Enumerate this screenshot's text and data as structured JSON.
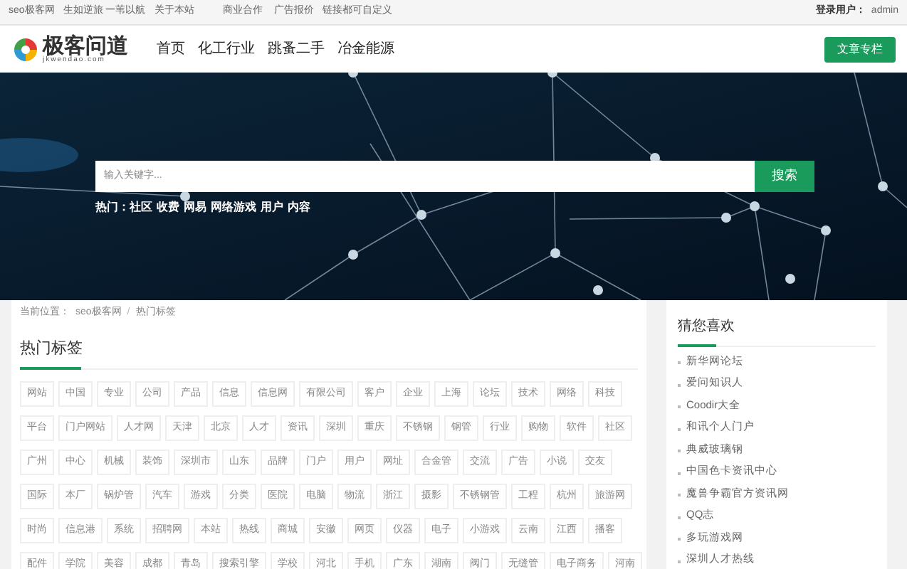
{
  "top_bar": {
    "links": [
      "seo极客网",
      "生如逆旅 一苇以航",
      "关于本站",
      "商业合作",
      "广告报价",
      "链接都可自定义"
    ],
    "user_label": "登录用户：",
    "user_name": "admin"
  },
  "header": {
    "logo_text": "极客问道",
    "logo_sub": "jkwendao.com",
    "nav": [
      "首页",
      "化工行业",
      "跳蚤二手",
      "冶金能源"
    ],
    "button": "文章专栏"
  },
  "banner": {
    "search": {
      "placeholder": "输入关键字...",
      "button": "搜索"
    },
    "hot_label": "热门：",
    "hot_links": [
      "社区",
      "收费",
      "网易",
      "网络游戏",
      "用户",
      "内容"
    ]
  },
  "breadcrumb": {
    "label": "当前位置：",
    "items": [
      "seo极客网",
      "热门标签"
    ],
    "separator": "/"
  },
  "tags": {
    "title": "热门标签",
    "rows": [
      [
        "网站",
        "中国",
        "专业",
        "公司",
        "产品",
        "信息",
        "信息网",
        "有限公司",
        "客户",
        "企业",
        "上海",
        "论坛",
        "技术",
        "网络",
        "科技"
      ],
      [
        "平台",
        "门户网站",
        "人才网",
        "天津",
        "北京",
        "人才",
        "资讯",
        "深圳",
        "重庆",
        "不锈钢",
        "钢管",
        "行业",
        "购物",
        "软件",
        "社区"
      ],
      [
        "广州",
        "中心",
        "机械",
        "装饰",
        "深圳市",
        "山东",
        "品牌",
        "门户",
        "用户",
        "网址",
        "合金管",
        "交流",
        "广告",
        "小说",
        "交友"
      ],
      [
        "国际",
        "本厂",
        "锅炉管",
        "汽车",
        "游戏",
        "分类",
        "医院",
        "电脑",
        "物流",
        "浙江",
        "摄影",
        "不锈钢管",
        "工程",
        "杭州",
        "旅游网"
      ],
      [
        "时尚",
        "信息港",
        "系统",
        "招聘网",
        "本站",
        "热线",
        "商城",
        "安徽",
        "网页",
        "仪器",
        "电子",
        "小游戏",
        "云南",
        "江西",
        "播客"
      ],
      [
        "配件",
        "学院",
        "美容",
        "成都",
        "青岛",
        "搜索引擎",
        "学校",
        "河北",
        "手机",
        "广东",
        "湖南",
        "阀门",
        "无缝管",
        "电子商务",
        "河南"
      ]
    ]
  },
  "sidebar": {
    "title": "猜您喜欢",
    "items": [
      "新华网论坛",
      "爱问知识人",
      "Coodir大全",
      "和讯个人门户",
      "典威玻璃钢",
      "中国色卡资讯中心",
      "魔兽争霸官方资讯网",
      "QQ志",
      "多玩游戏网",
      "深圳人才热线"
    ]
  }
}
